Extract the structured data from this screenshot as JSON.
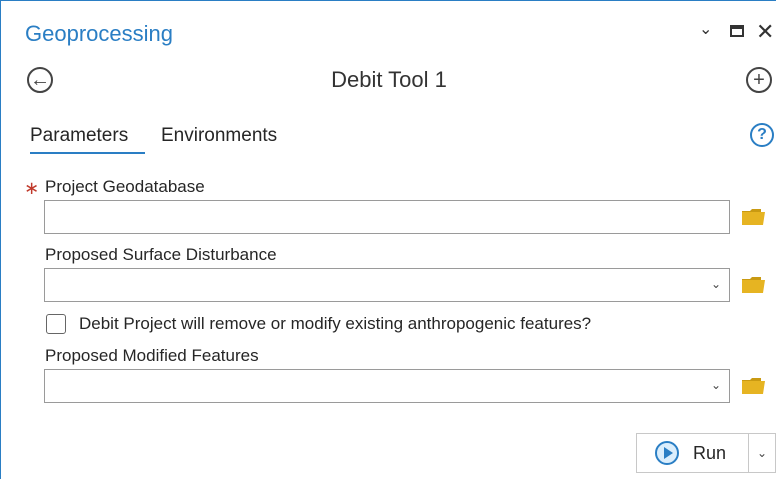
{
  "pane": {
    "title": "Geoprocessing",
    "controls": {
      "options_icon": "chevron-down-icon",
      "maximize_icon": "maximize-icon",
      "close_icon": "close-icon"
    }
  },
  "tool": {
    "title": "Debit Tool 1",
    "back_icon": "back-arrow-icon",
    "add_icon": "add-icon"
  },
  "tabs": [
    {
      "label": "Parameters",
      "active": true
    },
    {
      "label": "Environments",
      "active": false
    }
  ],
  "help_icon": "help-icon",
  "params": {
    "project_geodatabase": {
      "label": "Project Geodatabase",
      "required": true,
      "value": ""
    },
    "proposed_surface_disturbance": {
      "label": "Proposed Surface Disturbance",
      "value": ""
    },
    "modify_features_checkbox": {
      "label": "Debit Project will remove or modify existing anthropogenic features?",
      "checked": false
    },
    "proposed_modified_features": {
      "label": "Proposed Modified Features",
      "value": ""
    }
  },
  "run_button": {
    "label": "Run"
  },
  "colors": {
    "accent": "#2a7ec4",
    "folder": "#e6b422",
    "required": "#c0392b"
  }
}
